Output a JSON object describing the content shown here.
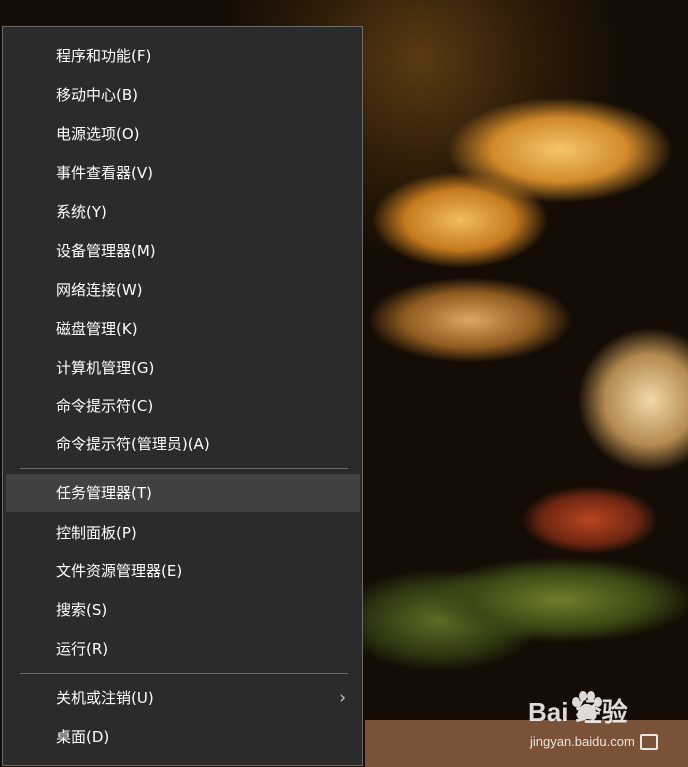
{
  "menu": {
    "items": [
      {
        "label": "程序和功能(F)"
      },
      {
        "label": "移动中心(B)"
      },
      {
        "label": "电源选项(O)"
      },
      {
        "label": "事件查看器(V)"
      },
      {
        "label": "系统(Y)"
      },
      {
        "label": "设备管理器(M)"
      },
      {
        "label": "网络连接(W)"
      },
      {
        "label": "磁盘管理(K)"
      },
      {
        "label": "计算机管理(G)"
      },
      {
        "label": "命令提示符(C)"
      },
      {
        "label": "命令提示符(管理员)(A)"
      },
      {
        "label": "任务管理器(T)",
        "highlighted": true
      },
      {
        "label": "控制面板(P)"
      },
      {
        "label": "文件资源管理器(E)"
      },
      {
        "label": "搜索(S)"
      },
      {
        "label": "运行(R)"
      },
      {
        "label": "关机或注销(U)",
        "submenu": true
      },
      {
        "label": "桌面(D)"
      }
    ],
    "submenu_glyph": "›"
  },
  "watermark": {
    "brand": "Bai  经验",
    "url": "jingyan.baidu.com"
  },
  "colors": {
    "menu_bg": "#2b2b2b",
    "menu_border": "#6b6b6b",
    "highlight": "#414141",
    "text": "#ffffff"
  }
}
